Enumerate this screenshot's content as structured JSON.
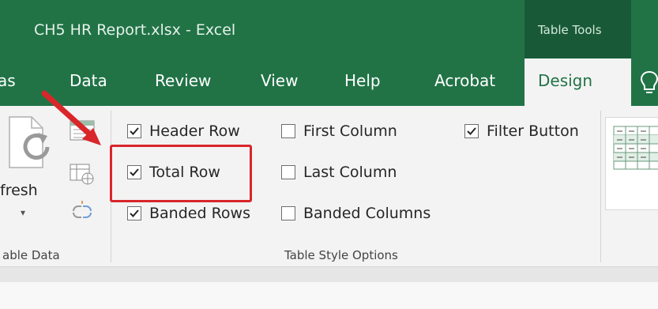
{
  "window": {
    "title": "CH5 HR Report.xlsx  -  Excel",
    "contextual_group": "Table Tools"
  },
  "tabs": [
    {
      "label": "as"
    },
    {
      "label": "Data"
    },
    {
      "label": "Review"
    },
    {
      "label": "View"
    },
    {
      "label": "Help"
    },
    {
      "label": "Acrobat"
    },
    {
      "label": "Design",
      "active": true
    }
  ],
  "ribbon": {
    "external_table_data": {
      "refresh_label": "fresh",
      "group_label": "able Data"
    },
    "table_style_options": {
      "group_label": "Table Style Options",
      "options": [
        {
          "label": "Header Row",
          "checked": true
        },
        {
          "label": "Total Row",
          "checked": true
        },
        {
          "label": "Banded Rows",
          "checked": true
        },
        {
          "label": "First Column",
          "checked": false
        },
        {
          "label": "Last Column",
          "checked": false
        },
        {
          "label": "Banded Columns",
          "checked": false
        },
        {
          "label": "Filter Button",
          "checked": true
        }
      ]
    }
  },
  "icons": [
    "refresh-icon",
    "properties-icon",
    "open-in-browser-icon",
    "unlink-icon",
    "lightbulb-icon",
    "table-style-gallery-icon"
  ],
  "colors": {
    "excel_green": "#217346",
    "dark_green": "#185a37",
    "callout_red": "#d9262b"
  }
}
